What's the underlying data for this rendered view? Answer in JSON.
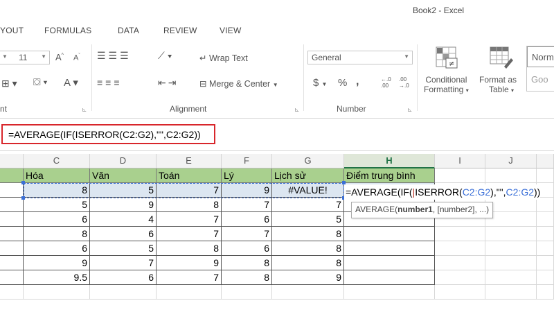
{
  "window": {
    "title": "Book2 - Excel"
  },
  "tabs": [
    "YOUT",
    "FORMULAS",
    "DATA",
    "REVIEW",
    "VIEW"
  ],
  "ribbon": {
    "font": {
      "size": "11",
      "group_label": "nt"
    },
    "alignment": {
      "wrap_text": "Wrap Text",
      "merge_center": "Merge & Center",
      "group_label": "Alignment"
    },
    "number": {
      "format": "General",
      "currency": "$",
      "percent": "%",
      "comma": ",",
      "inc_decimal": "←.0 .00",
      "dec_decimal": ".00 →.0",
      "group_label": "Number"
    },
    "styles": {
      "conditional_1": "Conditional",
      "conditional_2": "Formatting",
      "format_as_1": "Format as",
      "format_as_2": "Table",
      "normal": "Norm",
      "good": "Goo"
    }
  },
  "formula_bar": {
    "formula": "=AVERAGE(IF(ISERROR(C2:G2),\"\",C2:G2))"
  },
  "grid": {
    "columns": [
      {
        "key": "B",
        "label": ""
      },
      {
        "key": "C",
        "label": "C"
      },
      {
        "key": "D",
        "label": "D"
      },
      {
        "key": "E",
        "label": "E"
      },
      {
        "key": "F",
        "label": "F"
      },
      {
        "key": "G",
        "label": "G"
      },
      {
        "key": "H",
        "label": "H"
      },
      {
        "key": "I",
        "label": "I"
      },
      {
        "key": "J",
        "label": "J"
      }
    ],
    "selected_column": "H",
    "headers": [
      "Hóa",
      "Văn",
      "Toán",
      "Lý",
      "Lịch sử",
      "Điểm trung bình"
    ],
    "rows": [
      [
        "8",
        "5",
        "7",
        "9",
        "#VALUE!"
      ],
      [
        "5",
        "9",
        "8",
        "7",
        "7"
      ],
      [
        "6",
        "4",
        "7",
        "6",
        "5"
      ],
      [
        "8",
        "6",
        "7",
        "7",
        "8"
      ],
      [
        "6",
        "5",
        "8",
        "6",
        "8"
      ],
      [
        "9",
        "7",
        "9",
        "8",
        "8"
      ],
      [
        "9.5",
        "6",
        "7",
        "8",
        "9"
      ]
    ],
    "edit": {
      "prefix": "=AVERAGE(IF(",
      "fn": "ISERROR(",
      "ref1": "C2:G2",
      "mid": "),\"\",",
      "ref2": "C2:G2",
      "suffix": "))"
    },
    "tooltip": {
      "fn": "AVERAGE(",
      "arg1": "number1",
      "rest": ", [number2], ...)"
    }
  },
  "colors": {
    "header_fill": "#a9d08e",
    "row_selected_fill": "#dce6f1",
    "highlight_border": "#d8262b",
    "excel_green": "#217346"
  }
}
